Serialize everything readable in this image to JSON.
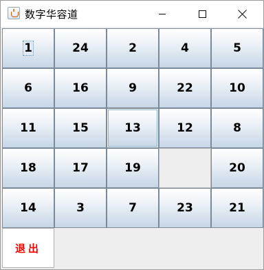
{
  "window": {
    "title": "数字华容道",
    "app_icon": "java-cup-icon"
  },
  "board": {
    "rows": [
      [
        "1",
        "24",
        "2",
        "4",
        "5"
      ],
      [
        "6",
        "16",
        "9",
        "22",
        "10"
      ],
      [
        "11",
        "15",
        "13",
        "12",
        "8"
      ],
      [
        "18",
        "17",
        "19",
        "",
        "20"
      ],
      [
        "14",
        "3",
        "7",
        "23",
        "21"
      ]
    ],
    "focused_tile": "1",
    "selected_tile": "13"
  },
  "exit_button": {
    "label": "退出",
    "color": "#ff0000"
  }
}
